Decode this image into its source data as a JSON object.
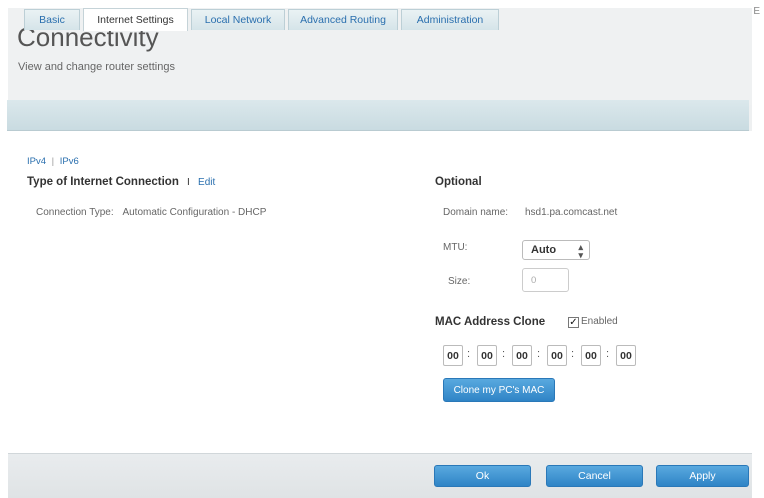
{
  "header": {
    "title": "Connectivity",
    "subtitle": "View and change router settings",
    "corner_mark": "E"
  },
  "tabs": [
    {
      "label": "Basic",
      "active": false
    },
    {
      "label": "Internet Settings",
      "active": true
    },
    {
      "label": "Local Network",
      "active": false
    },
    {
      "label": "Advanced Routing",
      "active": false
    },
    {
      "label": "Administration",
      "active": false
    }
  ],
  "ip_toggle": {
    "ipv4": "IPv4",
    "separator": "|",
    "ipv6": "IPv6"
  },
  "connection": {
    "heading": "Type of Internet Connection",
    "separator": "I",
    "edit_label": "Edit",
    "type_label": "Connection Type:",
    "type_value": "Automatic Configuration - DHCP"
  },
  "optional": {
    "heading": "Optional",
    "domain_label": "Domain name:",
    "domain_value": "hsd1.pa.comcast.net",
    "mtu_label": "MTU:",
    "mtu_value": "Auto",
    "size_label": "Size:",
    "size_value": "0"
  },
  "mac_clone": {
    "heading": "MAC Address Clone",
    "enabled_label": "Enabled",
    "enabled": true,
    "octets": [
      "00",
      "00",
      "00",
      "00",
      "00",
      "00"
    ],
    "separator": ":",
    "clone_button": "Clone my PC's MAC"
  },
  "footer": {
    "ok": "Ok",
    "cancel": "Cancel",
    "apply": "Apply"
  },
  "colors": {
    "accent": "#2f84c6",
    "link": "#2a6fae",
    "tabbar": "#d0e0e5"
  }
}
